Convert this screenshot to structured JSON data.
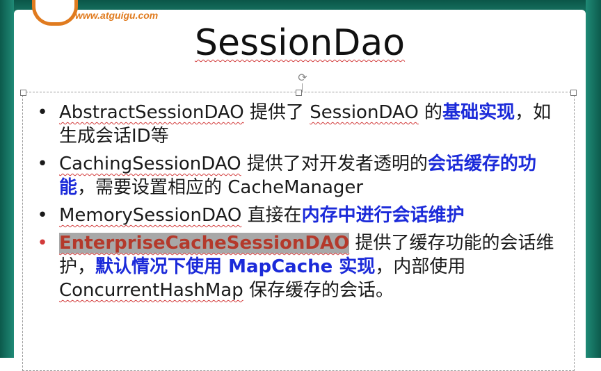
{
  "header": {
    "site_url": "www.atguigu.com"
  },
  "slide": {
    "title": "SessionDao",
    "bullets": [
      {
        "parts": [
          "AbstractSessionDAO",
          " 提供了 ",
          "SessionDAO",
          " 的",
          "基础实现",
          "，如生成会话ID等"
        ]
      },
      {
        "parts": [
          "CachingSessionDAO",
          " 提供了对开发者透明的",
          "会话缓存的功能",
          "，需要设置相应的 ",
          "CacheManager"
        ]
      },
      {
        "parts": [
          "MemorySessionDAO",
          " 直接在",
          "内存中进行会话维护"
        ]
      },
      {
        "parts": [
          "EnterpriseCacheSessionDAO",
          " 提供了缓存功能的会话维护，",
          "默认情况下使用 MapCache 实现",
          "，内部使用 ",
          "ConcurrentHashMap",
          " 保存缓存的会话。"
        ]
      }
    ]
  },
  "colors": {
    "frame": "#1b7f6c",
    "highlight_blue": "#1b2ad9",
    "highlight_red": "#b4392b",
    "logo_orange": "#e07b1f"
  }
}
